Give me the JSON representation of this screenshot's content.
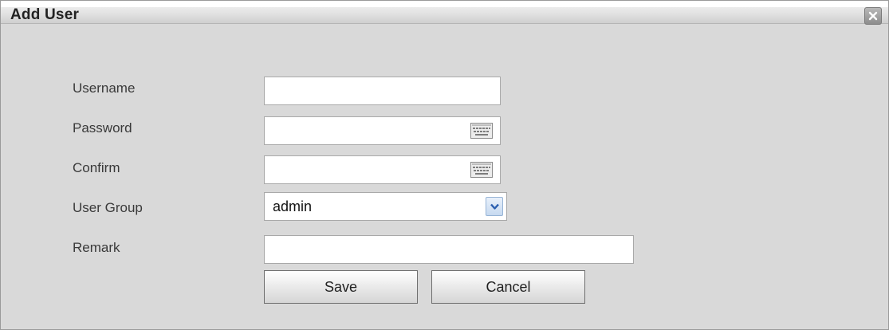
{
  "dialog": {
    "title": "Add User",
    "close_icon": "close-icon"
  },
  "form": {
    "username": {
      "label": "Username",
      "value": ""
    },
    "password": {
      "label": "Password",
      "value": "",
      "icon": "keyboard-icon"
    },
    "confirm": {
      "label": "Confirm",
      "value": "",
      "icon": "keyboard-icon"
    },
    "user_group": {
      "label": "User Group",
      "selected": "admin",
      "icon": "chevron-down-icon"
    },
    "remark": {
      "label": "Remark",
      "value": ""
    }
  },
  "buttons": {
    "save": "Save",
    "cancel": "Cancel"
  },
  "colors": {
    "dialog_bg": "#d9d9d9",
    "select_arrow": "#2a5fb0"
  }
}
